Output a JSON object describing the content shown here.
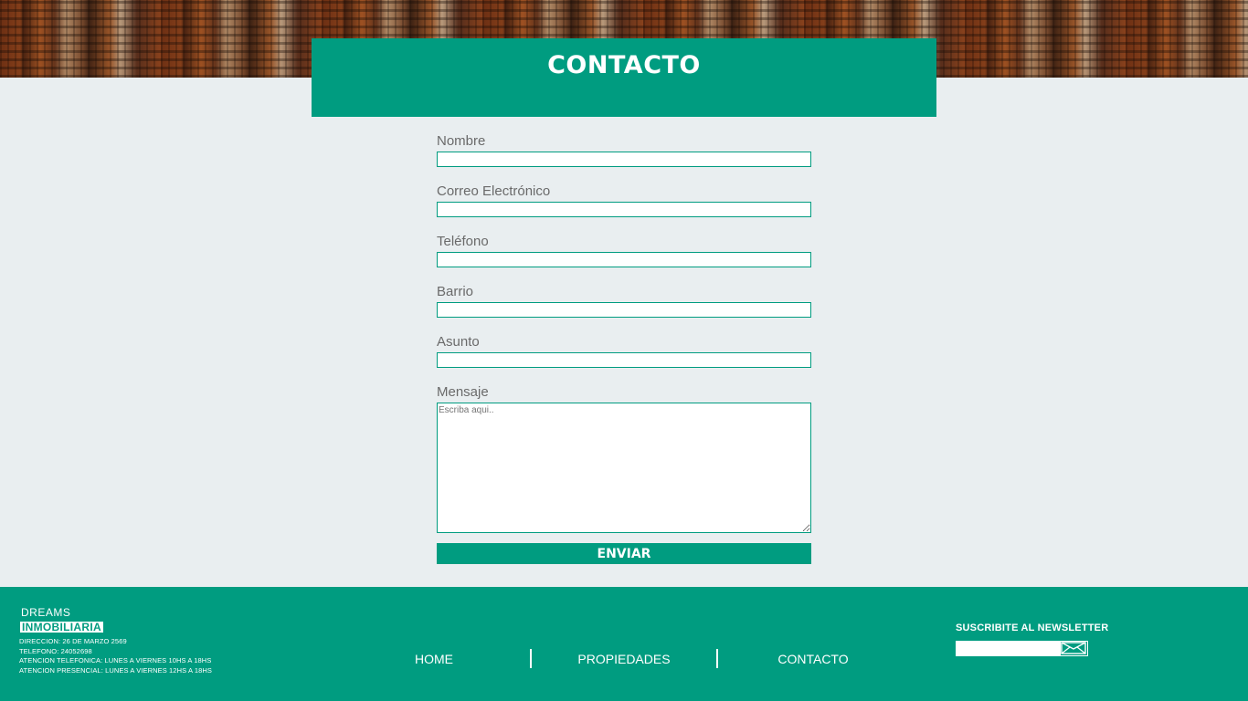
{
  "page": {
    "title": "CONTACTO"
  },
  "form": {
    "fields": [
      {
        "label": "Nombre",
        "value": ""
      },
      {
        "label": "Correo Electrónico",
        "value": ""
      },
      {
        "label": "Teléfono",
        "value": ""
      },
      {
        "label": "Barrio",
        "value": ""
      },
      {
        "label": "Asunto",
        "value": ""
      }
    ],
    "message": {
      "label": "Mensaje",
      "placeholder": "Escriba aqui..",
      "value": ""
    },
    "submit_label": "ENVIAR"
  },
  "footer": {
    "brand_line1": "DREAMS",
    "brand_line2": "INMOBILIARIA",
    "info": [
      "DIRECCION: 26 DE MARZO 2569",
      "TELEFONO: 24052698",
      "ATENCION TELEFONICA: LUNES A VIERNES 10HS A 18HS",
      "ATENCION PRESENCIAL: LUNES A VIERNES 12HS A 18HS"
    ],
    "nav": [
      "HOME",
      "PROPIEDADES",
      "CONTACTO"
    ],
    "newsletter_title": "SUSCRIBITE AL NEWSLETTER",
    "newsletter_value": "",
    "newsletter_icon": "envelope-icon"
  },
  "colors": {
    "accent": "#009c80",
    "background": "#e9eef0"
  }
}
